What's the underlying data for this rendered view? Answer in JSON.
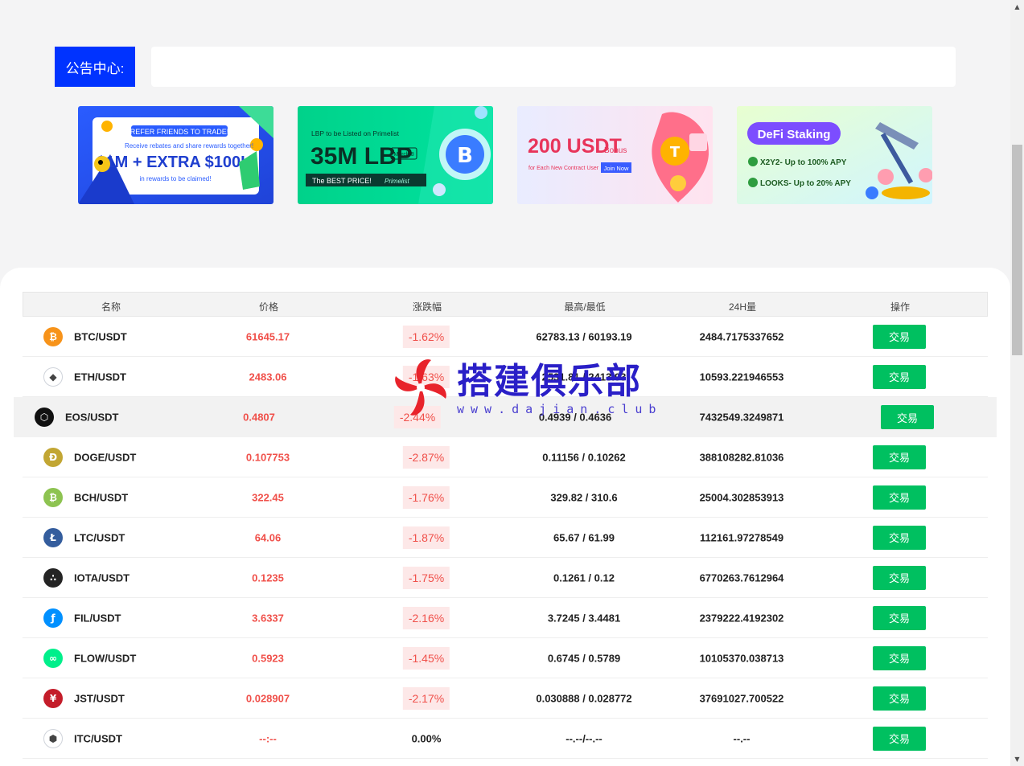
{
  "notice": {
    "label": "公告中心:"
  },
  "banners": [
    {
      "line1": "REFER FRIENDS TO TRADE!",
      "line2": "Receive rebates and share rewards together!",
      "line3": "$1M + EXTRA $100K",
      "line4": "in rewards to be claimed!"
    },
    {
      "line1": "LBP to be Listed on Primelist",
      "line2": "35M LBP",
      "line3": "March 8",
      "line4": "The BEST PRICE!",
      "line5": "Primelist"
    },
    {
      "line1": "200 USDT",
      "line2": "Bonus",
      "line3": "for Each New Contract User",
      "line4": "Join Now"
    },
    {
      "line1": "DeFi Staking",
      "line2": "X2Y2- Up to 100% APY",
      "line3": "LOOKS- Up to 20% APY"
    }
  ],
  "table": {
    "headers": {
      "name": "名称",
      "price": "价格",
      "change": "涨跌幅",
      "highlow": "最高/最低",
      "volume": "24H量",
      "action": "操作"
    },
    "rows": [
      {
        "pair": "BTC/USDT",
        "price": "61645.17",
        "change": "-1.62%",
        "highlow": "62783.13 / 60193.19",
        "volume": "2484.7175337652",
        "action": "交易",
        "icon": "bitcoin-icon",
        "color": "#f7931a",
        "glyph": "₿"
      },
      {
        "pair": "ETH/USDT",
        "price": "2483.06",
        "change": "-1.63%",
        "highlow": "2531.81 / 2413.93",
        "volume": "10593.221946553",
        "action": "交易",
        "icon": "ethereum-icon",
        "color": "#ffffff",
        "glyph": "◆"
      },
      {
        "pair": "EOS/USDT",
        "price": "0.4807",
        "change": "-2.44%",
        "highlow": "0.4939 / 0.4636",
        "volume": "7432549.3249871",
        "action": "交易",
        "icon": "eos-icon",
        "color": "#111111",
        "glyph": "⬡"
      },
      {
        "pair": "DOGE/USDT",
        "price": "0.107753",
        "change": "-2.87%",
        "highlow": "0.11156 / 0.10262",
        "volume": "388108282.81036",
        "action": "交易",
        "icon": "dogecoin-icon",
        "color": "#c2a633",
        "glyph": "Ð"
      },
      {
        "pair": "BCH/USDT",
        "price": "322.45",
        "change": "-1.76%",
        "highlow": "329.82 / 310.6",
        "volume": "25004.302853913",
        "action": "交易",
        "icon": "bitcoin-cash-icon",
        "color": "#8dc351",
        "glyph": "₿"
      },
      {
        "pair": "LTC/USDT",
        "price": "64.06",
        "change": "-1.87%",
        "highlow": "65.67 / 61.99",
        "volume": "112161.97278549",
        "action": "交易",
        "icon": "litecoin-icon",
        "color": "#345d9d",
        "glyph": "Ł"
      },
      {
        "pair": "IOTA/USDT",
        "price": "0.1235",
        "change": "-1.75%",
        "highlow": "0.1261 / 0.12",
        "volume": "6770263.7612964",
        "action": "交易",
        "icon": "iota-icon",
        "color": "#242424",
        "glyph": "∴"
      },
      {
        "pair": "FIL/USDT",
        "price": "3.6337",
        "change": "-2.16%",
        "highlow": "3.7245 / 3.4481",
        "volume": "2379222.4192302",
        "action": "交易",
        "icon": "filecoin-icon",
        "color": "#0090ff",
        "glyph": "ƒ"
      },
      {
        "pair": "FLOW/USDT",
        "price": "0.5923",
        "change": "-1.45%",
        "highlow": "0.6745 / 0.5789",
        "volume": "10105370.038713",
        "action": "交易",
        "icon": "flow-icon",
        "color": "#00ef8b",
        "glyph": "∞"
      },
      {
        "pair": "JST/USDT",
        "price": "0.028907",
        "change": "-2.17%",
        "highlow": "0.030888 / 0.028772",
        "volume": "37691027.700522",
        "action": "交易",
        "icon": "just-icon",
        "color": "#c41d2a",
        "glyph": "¥"
      },
      {
        "pair": "ITC/USDT",
        "price": "--:--",
        "change": "0.00%",
        "highlow": "--.--/--.--",
        "volume": "--.--",
        "action": "交易",
        "icon": "itc-icon",
        "color": "#ffffff",
        "glyph": "⬢"
      }
    ]
  },
  "watermark": {
    "title": "搭建俱乐部",
    "url": "www.dajian.club"
  }
}
